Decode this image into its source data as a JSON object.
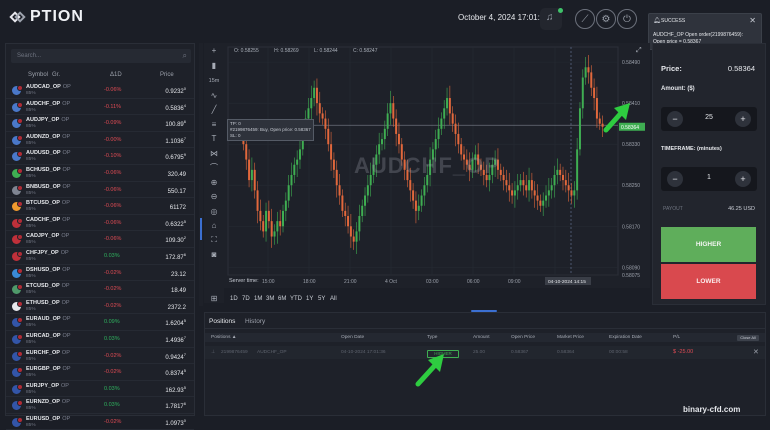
{
  "header": {
    "brand": "PTION",
    "datetime": "October 4, 2024 17:01:37"
  },
  "notification": {
    "title": "SUCCESS",
    "line1": "AUDCHF_OP Open order(2199876459):",
    "line2": "Open price = 0.58367"
  },
  "sidebar": {
    "search_placeholder": "Search...",
    "headers": {
      "symbol": "Symbol",
      "group": "Gr.",
      "change": "Δ1D",
      "price": "Price"
    },
    "assets": [
      {
        "name": "AUDCAD_OP",
        "tag": "OP",
        "payout": "85%",
        "change": "-0.06%",
        "price_main": "0.9232",
        "price_sup": "0",
        "icon": "#4a78c9"
      },
      {
        "name": "AUDCHF_OP",
        "tag": "OP",
        "payout": "85%",
        "change": "-0.11%",
        "price_main": "0.5836",
        "price_sup": "4",
        "icon": "#4a78c9"
      },
      {
        "name": "AUDJPY_OP",
        "tag": "OP",
        "payout": "85%",
        "change": "-0.09%",
        "price_main": "100.89",
        "price_sup": "6",
        "icon": "#4a78c9"
      },
      {
        "name": "AUDNZD_OP",
        "tag": "OP",
        "payout": "85%",
        "change": "-0.00%",
        "price_main": "1.1036",
        "price_sup": "7",
        "icon": "#4a78c9"
      },
      {
        "name": "AUDUSD_OP",
        "tag": "OP",
        "payout": "85%",
        "change": "-0.10%",
        "price_main": "0.6795",
        "price_sup": "9",
        "icon": "#4a78c9"
      },
      {
        "name": "BCHUSD_OP",
        "tag": "OP",
        "payout": "85%",
        "change": "-0.06%",
        "price_main": "320.49",
        "price_sup": "",
        "icon": "#3fae52"
      },
      {
        "name": "BNBUSD_OP",
        "tag": "OP",
        "payout": "85%",
        "change": "-0.06%",
        "price_main": "550.17",
        "price_sup": "",
        "icon": "#7f8592"
      },
      {
        "name": "BTCUSD_OP",
        "tag": "OP",
        "payout": "85%",
        "change": "-0.06%",
        "price_main": "61172",
        "price_sup": "",
        "icon": "#f09a2e"
      },
      {
        "name": "CADCHF_OP",
        "tag": "OP",
        "payout": "85%",
        "change": "-0.06%",
        "price_main": "0.6322",
        "price_sup": "5",
        "icon": "#c0303a"
      },
      {
        "name": "CADJPY_OP",
        "tag": "OP",
        "payout": "85%",
        "change": "-0.06%",
        "price_main": "109.30",
        "price_sup": "2",
        "icon": "#c0303a"
      },
      {
        "name": "CHFJPY_OP",
        "tag": "OP",
        "payout": "85%",
        "change": "0.03%",
        "price_main": "172.87",
        "price_sup": "6",
        "icon": "#c0303a"
      },
      {
        "name": "DSHUSD_OP",
        "tag": "OP",
        "payout": "85%",
        "change": "-0.02%",
        "price_main": "23.12",
        "price_sup": "",
        "icon": "#3a8ad6"
      },
      {
        "name": "ETCUSD_OP",
        "tag": "OP",
        "payout": "85%",
        "change": "-0.02%",
        "price_main": "18.49",
        "price_sup": "",
        "icon": "#4f9a6a"
      },
      {
        "name": "ETHUSD_OP",
        "tag": "OP",
        "payout": "85%",
        "change": "-0.02%",
        "price_main": "2372.2",
        "price_sup": "",
        "icon": "#e6e8ec"
      },
      {
        "name": "EURAUD_OP",
        "tag": "OP",
        "payout": "85%",
        "change": "0.09%",
        "price_main": "1.6204",
        "price_sup": "5",
        "icon": "#3355a8"
      },
      {
        "name": "EURCAD_OP",
        "tag": "OP",
        "payout": "85%",
        "change": "0.03%",
        "price_main": "1.4936",
        "price_sup": "7",
        "icon": "#3355a8"
      },
      {
        "name": "EURCHF_OP",
        "tag": "OP",
        "payout": "85%",
        "change": "-0.02%",
        "price_main": "0.9424",
        "price_sup": "7",
        "icon": "#3355a8"
      },
      {
        "name": "EURGBP_OP",
        "tag": "OP",
        "payout": "85%",
        "change": "-0.02%",
        "price_main": "0.8374",
        "price_sup": "5",
        "icon": "#3355a8"
      },
      {
        "name": "EURJPY_OP",
        "tag": "OP",
        "payout": "85%",
        "change": "0.03%",
        "price_main": "162.93",
        "price_sup": "5",
        "icon": "#3355a8"
      },
      {
        "name": "EURNZD_OP",
        "tag": "OP",
        "payout": "85%",
        "change": "0.03%",
        "price_main": "1.7817",
        "price_sup": "6",
        "icon": "#3355a8"
      },
      {
        "name": "EURUSD_OP",
        "tag": "OP",
        "payout": "85%",
        "change": "-0.02%",
        "price_main": "1.0973",
        "price_sup": "0",
        "icon": "#3355a8"
      }
    ]
  },
  "chart": {
    "symbol_watermark": "AUDCHF_OP",
    "ohlc": {
      "o": "O: 0.58255",
      "h": "H: 0.58269",
      "l": "L: 0.58244",
      "c": "C: 0.58247"
    },
    "interval": "15m",
    "trade_label": {
      "line1": "TP: 0",
      "line2": "#2199876459: Buy, Open price: 0.58367",
      "line3": "SL: 0"
    },
    "server_time_label": "Server time:",
    "crosshair_time": "04-10-2024 14:15",
    "current_price_tag": "0.58364",
    "ranges": [
      "1D",
      "7D",
      "1M",
      "3M",
      "6M",
      "YTD",
      "1Y",
      "5Y",
      "All"
    ]
  },
  "chart_data": {
    "type": "candlestick",
    "y_ticks": [
      "0.58490",
      "0.58410",
      "0.58330",
      "0.58250",
      "0.58170",
      "0.58090",
      "0.58075"
    ],
    "x_ticks": [
      "15:00",
      "18:00",
      "21:00",
      "4 Oct",
      "03:00",
      "06:00",
      "09:00",
      "12:00"
    ],
    "ylim": [
      0.58075,
      0.585
    ],
    "open_price_line": 0.58367,
    "closes": [
      0.5833,
      0.583,
      0.5826,
      0.5828,
      0.5824,
      0.582,
      0.5818,
      0.5816,
      0.582,
      0.5818,
      0.5815,
      0.5816,
      0.5818,
      0.5817,
      0.582,
      0.5822,
      0.5825,
      0.5827,
      0.5829,
      0.583,
      0.5832,
      0.5836,
      0.5838,
      0.584,
      0.5842,
      0.5844,
      0.5841,
      0.5839,
      0.5838,
      0.5836,
      0.5833,
      0.583,
      0.5828,
      0.5825,
      0.5823,
      0.582,
      0.5819,
      0.5817,
      0.5815,
      0.5814,
      0.5816,
      0.5819,
      0.5821,
      0.5823,
      0.5825,
      0.5827,
      0.5829,
      0.5831,
      0.5833,
      0.5834,
      0.5836,
      0.5839,
      0.5841,
      0.5838,
      0.5835,
      0.5833,
      0.583,
      0.5828,
      0.5826,
      0.5824,
      0.5822,
      0.582,
      0.5821,
      0.5823,
      0.5825,
      0.5827,
      0.583,
      0.5832,
      0.5834,
      0.5836,
      0.5838,
      0.584,
      0.5842,
      0.5839,
      0.5837,
      0.5835,
      0.5833,
      0.5831,
      0.583,
      0.5829,
      0.5828,
      0.583,
      0.5831,
      0.5829,
      0.5828,
      0.5827,
      0.5826,
      0.5827,
      0.5829,
      0.583,
      0.5828,
      0.5827,
      0.5826,
      0.5825,
      0.5824,
      0.5823,
      0.5824,
      0.5825,
      0.5826,
      0.5825,
      0.5824,
      0.5826,
      0.5824,
      0.5823,
      0.5822,
      0.5821,
      0.5822,
      0.5823,
      0.5824,
      0.5825,
      0.5827,
      0.5828,
      0.5827,
      0.5826,
      0.5825,
      0.5824,
      0.5823,
      0.5824,
      0.5832,
      0.584,
      0.5846,
      0.5848,
      0.5847,
      0.5844,
      0.5842,
      0.5838,
      0.5837,
      0.58364
    ]
  },
  "right_panel": {
    "price_label": "Price:",
    "price_value": "0.58364",
    "amount_label": "Amount: ($)",
    "amount_value": "25",
    "timeframe_label": "TIMEFRAME: (minutes)",
    "timeframe_value": "1",
    "payout_label": "PAYOUT",
    "payout_value": "46.25 USD",
    "higher_label": "HIGHER",
    "lower_label": "LOWER"
  },
  "positions": {
    "tabs": [
      "Positions",
      "History"
    ],
    "headers": [
      "Positions ▲",
      "Open Date",
      "Type",
      "Amount",
      "Open Price",
      "Market Price",
      "Expiration Date",
      "P/L"
    ],
    "close_all": "Close All",
    "row": {
      "id": "2199876459",
      "symbol": "AUDCHF_OP",
      "open_date": "04-10-2024 17:01:36",
      "type": "HIGHER",
      "amount": "25.00",
      "open_price": "0.58367",
      "market_price": "0.58364",
      "expiration": "00:00:58",
      "pl": "$ -25.00"
    }
  },
  "site_watermark": "binary-cfd.com",
  "colors": {
    "up": "#3fae52",
    "down": "#e2683c",
    "higher": "#5fae5b",
    "lower": "#d9494e",
    "arrow": "#2ecc40"
  }
}
